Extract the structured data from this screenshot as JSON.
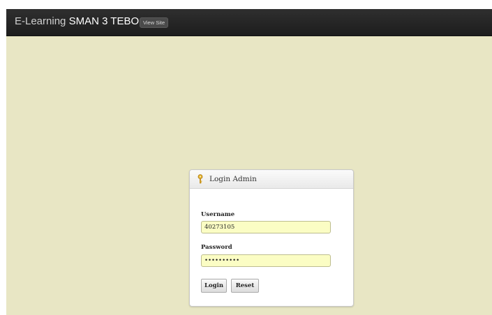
{
  "header": {
    "brand_prefix": "E-Learning ",
    "brand_name": "SMAN 3 TEBO",
    "view_site_label": "View Site"
  },
  "login": {
    "title": "Login Admin",
    "icon": "key-icon",
    "username_label": "Username",
    "username_value": "40273105",
    "password_label": "Password",
    "password_value": "••••••••••",
    "login_button": "Login",
    "reset_button": "Reset"
  },
  "colors": {
    "background": "#e8e6c4",
    "topbar": "#222222",
    "input_bg": "#fbfdc4"
  }
}
